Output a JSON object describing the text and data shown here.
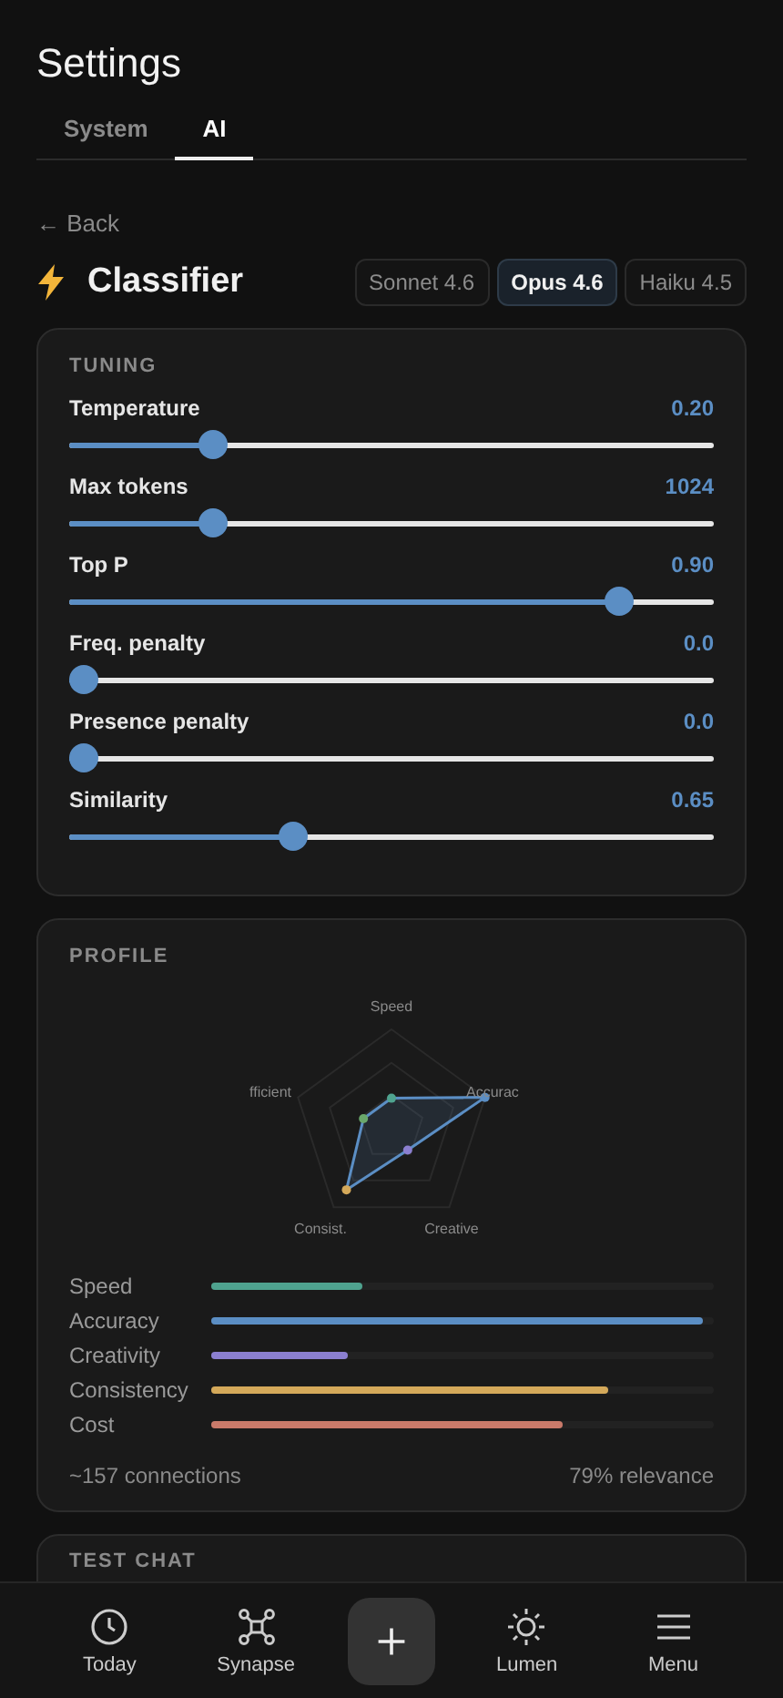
{
  "header": {
    "title": "Settings"
  },
  "tabs": [
    {
      "label": "System",
      "selected": false
    },
    {
      "label": "AI",
      "selected": true
    }
  ],
  "back_link": "← Back",
  "agent": {
    "title": "Classifier"
  },
  "models": [
    {
      "label": "Sonnet 4.6",
      "selected": false
    },
    {
      "label": "Opus 4.6",
      "selected": true
    },
    {
      "label": "Haiku 4.5",
      "selected": false
    }
  ],
  "tuning": {
    "heading": "TUNING",
    "sliders": [
      {
        "name": "Temperature",
        "reading": "0.20",
        "level": 0.21
      },
      {
        "name": "Max tokens",
        "reading": "1024",
        "level": 0.21
      },
      {
        "name": "Top P",
        "reading": "0.90",
        "level": 0.87
      },
      {
        "name": "Freq. penalty",
        "reading": "0.0",
        "level": 0
      },
      {
        "name": "Presence penalty",
        "reading": "0.0",
        "level": 0
      },
      {
        "name": "Similarity",
        "reading": "0.65",
        "level": 0.34
      }
    ]
  },
  "profile": {
    "heading": "PROFILE",
    "radar": [
      {
        "label": "Speed",
        "color": "#4fa38f"
      },
      {
        "label": "Accurac",
        "color": "#5b8ec4"
      },
      {
        "label": "Creative",
        "color": "#8b7fd0"
      },
      {
        "label": "Consist.",
        "color": "#d4a95a"
      },
      {
        "label": "fficient",
        "color": "#6aa86b"
      }
    ],
    "bars": [
      {
        "name": "Speed",
        "level": 0.3,
        "color": "#4fa38f"
      },
      {
        "name": "Accuracy",
        "level": 0.98,
        "color": "#5b8ec4"
      },
      {
        "name": "Creativity",
        "level": 0.27,
        "color": "#8b7fd0"
      },
      {
        "name": "Consistency",
        "level": 0.79,
        "color": "#d4a95a"
      },
      {
        "name": "Cost",
        "level": 0.7,
        "color": "#c97a6a"
      }
    ],
    "connections": "~157 connections",
    "relevance": "79% relevance"
  },
  "test_chat": {
    "heading": "TEST CHAT"
  },
  "nav": [
    {
      "kind": "clock",
      "label": "Today"
    },
    {
      "kind": "graph",
      "label": "Synapse"
    },
    {
      "kind": "add"
    },
    {
      "kind": "sun",
      "label": "Lumen"
    },
    {
      "kind": "menu",
      "label": "Menu"
    }
  ]
}
